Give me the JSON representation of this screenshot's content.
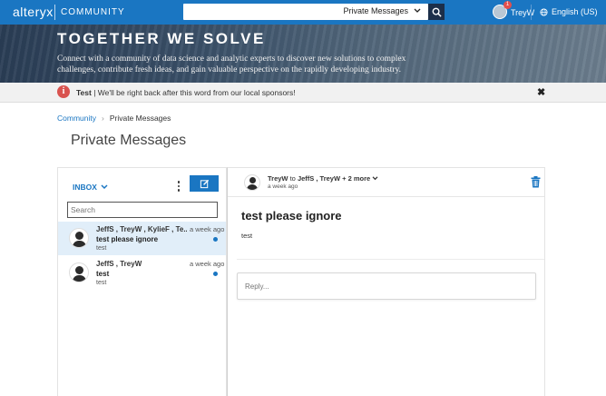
{
  "header": {
    "logo": "alteryx",
    "logo_sub": "COMMUNITY",
    "search_scope": "Private Messages",
    "notification_count": "1",
    "username": "TreyW",
    "language": "English (US)"
  },
  "hero": {
    "title": "TOGETHER WE SOLVE",
    "text": "Connect with a community of data science and analytic experts to discover new solutions to complex challenges, contribute fresh ideas, and gain valuable perspective on the rapidly developing industry."
  },
  "alert": {
    "icon_label": "i",
    "title": "Test",
    "message": " | We'll be right back after this word from our local sponsors!"
  },
  "breadcrumb": {
    "root": "Community",
    "current": "Private Messages"
  },
  "page_title": "Private Messages",
  "inbox": {
    "label": "INBOX",
    "search_placeholder": "Search",
    "messages": [
      {
        "from": "JeffS , TreyW , KylieF , Te...",
        "time": "a week ago",
        "subject": "test please ignore",
        "preview": "test"
      },
      {
        "from": "JeffS , TreyW",
        "time": "a week ago",
        "subject": "test",
        "preview": "test"
      }
    ]
  },
  "thread": {
    "sender": "TreyW",
    "to_word": " to ",
    "recipients": "JeffS , TreyW + 2 more",
    "time": "a week ago",
    "subject": "test please ignore",
    "body": "test",
    "reply_placeholder": "Reply..."
  },
  "colors": {
    "brand": "#1a76c2",
    "alert": "#d9534f",
    "active_row": "#e1eef9"
  }
}
